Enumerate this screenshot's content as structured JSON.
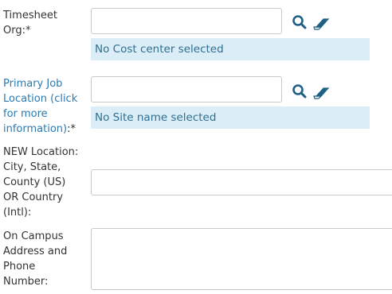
{
  "fields": {
    "timesheet_org": {
      "label": "Timesheet\nOrg:*",
      "value": "",
      "status": "No Cost center selected",
      "search_icon": "search-icon",
      "clear_icon": "eraser-icon"
    },
    "primary_job_location": {
      "label_link": "Primary Job\nLocation (click\nfor more\ninformation)",
      "label_suffix": ":*",
      "value": "",
      "status": "No Site name selected",
      "search_icon": "search-icon",
      "clear_icon": "eraser-icon"
    },
    "new_location": {
      "label": "NEW Location:\nCity, State,\nCounty (US)\nOR Country\n(Intl):",
      "value": ""
    },
    "on_campus_address": {
      "label": "On Campus\nAddress and\nPhone\nNumber:",
      "value": ""
    }
  },
  "colors": {
    "link": "#2a7ab0",
    "info_bg": "#dbeef8",
    "info_text": "#2f6f8f",
    "icon": "#1f5f85"
  }
}
